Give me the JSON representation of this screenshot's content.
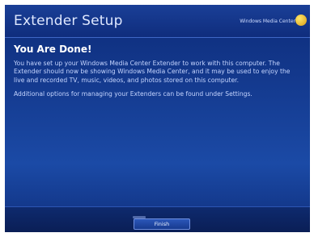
{
  "window": {
    "title": "Extender Setup",
    "brand": "Windows Media Center"
  },
  "content": {
    "heading": "You Are Done!",
    "paragraph1": "You have set up your Windows Media Center Extender to work with this computer. The Extender should now be showing Windows Media Center, and it may be used to enjoy the live and recorded TV, music, videos, and photos stored on this computer.",
    "paragraph2": "Additional options for managing your Extenders can be found under Settings."
  },
  "footer": {
    "finish_label": "Finish"
  }
}
